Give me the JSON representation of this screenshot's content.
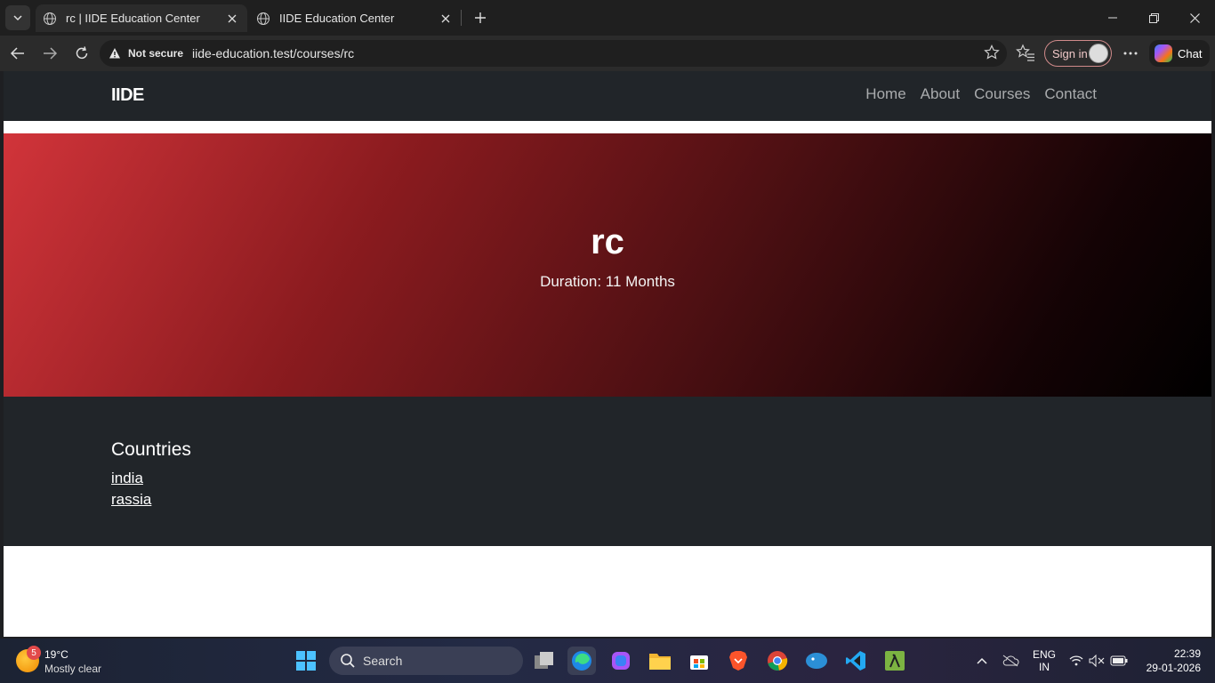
{
  "browser": {
    "tabs": [
      {
        "title": "rc | IIDE Education Center",
        "active": true
      },
      {
        "title": "IIDE Education Center",
        "active": false
      }
    ],
    "address": {
      "security_label": "Not secure",
      "url": "iide-education.test/courses/rc"
    },
    "sign_in_label": "Sign in",
    "chat_label": "Chat"
  },
  "site": {
    "brand": "IIDE",
    "nav": [
      "Home",
      "About",
      "Courses",
      "Contact"
    ],
    "hero": {
      "title": "rc",
      "duration": "Duration: 11 Months"
    },
    "countries": {
      "heading": "Countries",
      "items": [
        "india",
        "rassia"
      ]
    }
  },
  "taskbar": {
    "weather": {
      "badge": "5",
      "temp": "19°C",
      "condition": "Mostly clear"
    },
    "search_label": "Search",
    "lang_line1": "ENG",
    "lang_line2": "IN",
    "time": "22:39",
    "date": "29-01-2026"
  },
  "colors": {
    "hero_start": "#d1343a",
    "hero_end": "#000000",
    "navbar": "#212529"
  }
}
